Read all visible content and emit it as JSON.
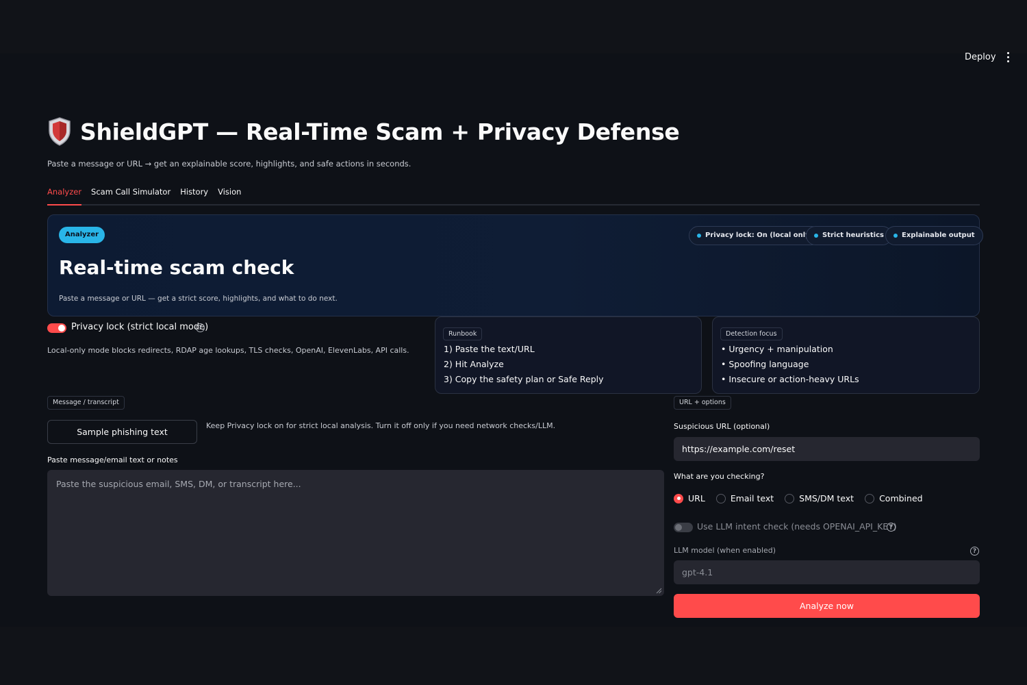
{
  "header": {
    "deploy_label": "Deploy"
  },
  "page": {
    "title": "ShieldGPT — Real-Time Scam + Privacy Defense",
    "subtitle": "Paste a message or URL → get an explainable score, highlights, and safe actions in seconds."
  },
  "tabs": [
    {
      "label": "Analyzer",
      "active": true
    },
    {
      "label": "Scam Call Simulator",
      "active": false
    },
    {
      "label": "History",
      "active": false
    },
    {
      "label": "Vision",
      "active": false
    }
  ],
  "hero": {
    "badge": "Analyzer",
    "title": "Real-time scam check",
    "subtitle": "Paste a message or URL — get a strict score, highlights, and what to do next.",
    "chips": [
      "Privacy lock: On (local only)",
      "Strict heuristics",
      "Explainable output"
    ]
  },
  "privacy": {
    "toggle_label": "Privacy lock (strict local mode)",
    "enabled": true,
    "note": "Local-only mode blocks redirects, RDAP age lookups, TLS checks, OpenAI, ElevenLabs, API calls."
  },
  "runbook": {
    "tag": "Runbook",
    "steps": [
      "1) Paste the text/URL",
      "2) Hit Analyze",
      "3) Copy the safety plan or Safe Reply"
    ]
  },
  "detection": {
    "tag": "Detection focus",
    "items": [
      "• Urgency + manipulation",
      "• Spoofing language",
      "• Insecure or action-heavy URLs"
    ]
  },
  "message": {
    "section_tag": "Message / transcript",
    "sample_button": "Sample phishing text",
    "hint": "Keep Privacy lock on for strict local analysis. Turn it off only if you need network checks/LLM.",
    "textarea_label": "Paste message/email text or notes",
    "textarea_placeholder": "Paste the suspicious email, SMS, DM, or transcript here..."
  },
  "url_options": {
    "section_tag": "URL + options",
    "url_label": "Suspicious URL (optional)",
    "url_value": "https://example.com/reset",
    "checking_label": "What are you checking?",
    "radio_options": [
      "URL",
      "Email text",
      "SMS/DM text",
      "Combined"
    ],
    "selected": "URL",
    "llm_toggle_label": "Use LLM intent check (needs OPENAI_API_KEY)",
    "llm_enabled": false,
    "model_label": "LLM model (when enabled)",
    "model_value": "gpt-4.1",
    "analyze_button": "Analyze now"
  },
  "colors": {
    "accent": "#ff4b4b",
    "info": "#29b5e8",
    "background": "#0e1117",
    "input_bg": "#262730"
  },
  "icons": {
    "title_icon": "shield-icon",
    "help_icon": "help-circle-icon",
    "menu_icon": "kebab-menu-icon"
  }
}
